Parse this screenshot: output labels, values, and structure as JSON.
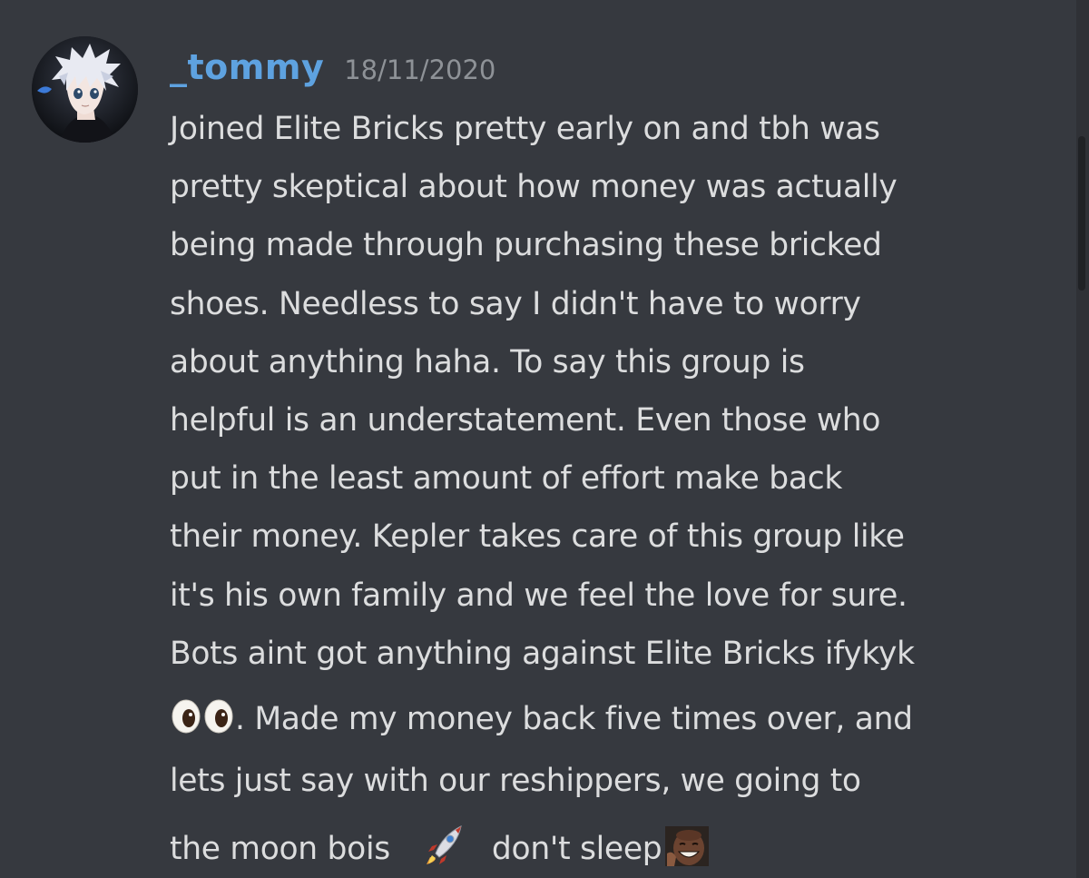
{
  "message": {
    "author": "_tommy",
    "timestamp": "18/11/2020",
    "author_color": "#5ea2e0",
    "avatar_icon": "anime-character-avatar",
    "lines": [
      "Joined Elite Bricks pretty early on and tbh was",
      "pretty skeptical about how money was actually",
      "being made through purchasing these bricked",
      "shoes. Needless to say I didn't have to worry",
      "about anything haha. To say this group is",
      "helpful is an understatement. Even those who",
      "put in the least amount of effort make back",
      "their money. Kepler takes care of this group like",
      "it's his own family and we feel the love for sure.",
      "Bots aint got anything against Elite Bricks ifykyk"
    ],
    "line_eyes_after": ". Made my money back five times over, and",
    "line_reshippers": "lets just say with our reshippers, we going to",
    "line_moon_before": "the moon bois",
    "line_moon_after": "don't sleep",
    "emojis": {
      "eyes": "eyes-emoji",
      "rocket": "rocket-emoji",
      "custom": "laughing-man-emoji"
    }
  },
  "theme": {
    "background": "#36393f",
    "text": "#dcddde",
    "muted": "#8e9297"
  }
}
